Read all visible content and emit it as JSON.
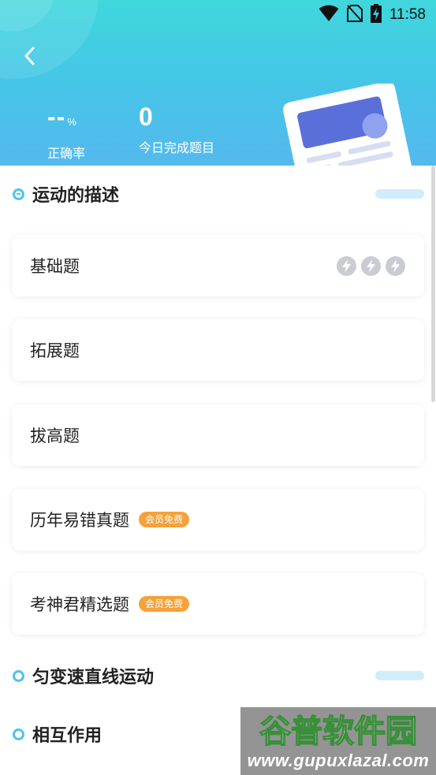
{
  "status_bar": {
    "time": "11:58",
    "icons": [
      "wifi-icon",
      "no-sim-icon",
      "battery-charging-icon"
    ]
  },
  "header": {
    "back_icon": "chevron-left-icon",
    "accuracy": {
      "value": "--",
      "unit": "%",
      "label": "正确率"
    },
    "completed": {
      "value": "0",
      "label": "今日完成题目"
    },
    "illustration": "paper-illustration"
  },
  "sections": [
    {
      "title": "运动的描述",
      "expanded": true,
      "items": [
        {
          "title": "基础题",
          "badge": "",
          "bolts": 3
        },
        {
          "title": "拓展题",
          "badge": ""
        },
        {
          "title": "拔高题",
          "badge": ""
        },
        {
          "title": "历年易错真题",
          "badge": "会员免费"
        },
        {
          "title": "考神君精选题",
          "badge": "会员免费"
        }
      ]
    },
    {
      "title": "匀变速直线运动",
      "expanded": false
    },
    {
      "title": "相互作用",
      "expanded": false
    }
  ],
  "watermark": {
    "logo_text": "谷普软件园",
    "url": "www.gupuxlazal.com"
  },
  "colors": {
    "header_start": "#3fd7dc",
    "header_end": "#55b9ee",
    "accent": "#4ec4e8",
    "badge": "#f5a23a",
    "pill": "#cfeefa"
  }
}
